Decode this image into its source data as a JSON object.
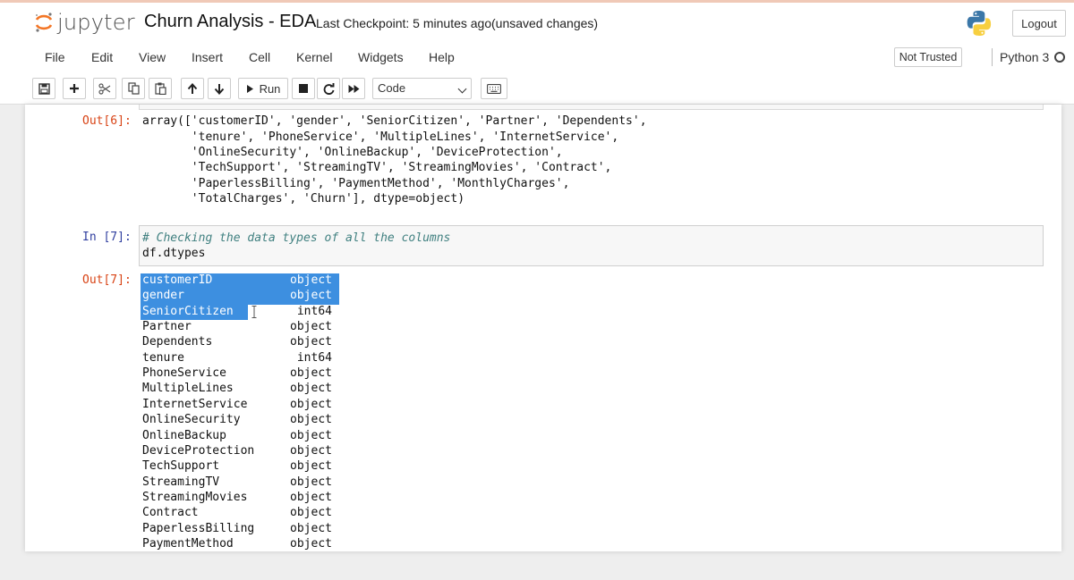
{
  "header": {
    "logo_text": "jupyter",
    "notebook_title": "Churn Analysis - EDA",
    "checkpoint": "Last Checkpoint: 5 minutes ago",
    "unsaved": "(unsaved changes)",
    "logout_label": "Logout"
  },
  "menubar": {
    "items": [
      "File",
      "Edit",
      "View",
      "Insert",
      "Cell",
      "Kernel",
      "Widgets",
      "Help"
    ],
    "trust_label": "Not Trusted",
    "kernel_name": "Python 3"
  },
  "toolbar": {
    "run_label": "Run",
    "cell_type": "Code"
  },
  "cells": {
    "out6_prompt": "Out[6]:",
    "out6_lines": [
      "array(['customerID', 'gender', 'SeniorCitizen', 'Partner', 'Dependents',",
      "       'tenure', 'PhoneService', 'MultipleLines', 'InternetService',",
      "       'OnlineSecurity', 'OnlineBackup', 'DeviceProtection',",
      "       'TechSupport', 'StreamingTV', 'StreamingMovies', 'Contract',",
      "       'PaperlessBilling', 'PaymentMethod', 'MonthlyCharges',",
      "       'TotalCharges', 'Churn'], dtype=object)"
    ],
    "in7_prompt": "In [7]:",
    "in7_comment": "# Checking the data types of all the columns",
    "in7_code": "df.dtypes",
    "out7_prompt": "Out[7]:",
    "dtypes": [
      {
        "name": "customerID",
        "type": "object"
      },
      {
        "name": "gender",
        "type": "object"
      },
      {
        "name": "SeniorCitizen",
        "type": "int64"
      },
      {
        "name": "Partner",
        "type": "object"
      },
      {
        "name": "Dependents",
        "type": "object"
      },
      {
        "name": "tenure",
        "type": "int64"
      },
      {
        "name": "PhoneService",
        "type": "object"
      },
      {
        "name": "MultipleLines",
        "type": "object"
      },
      {
        "name": "InternetService",
        "type": "object"
      },
      {
        "name": "OnlineSecurity",
        "type": "object"
      },
      {
        "name": "OnlineBackup",
        "type": "object"
      },
      {
        "name": "DeviceProtection",
        "type": "object"
      },
      {
        "name": "TechSupport",
        "type": "object"
      },
      {
        "name": "StreamingTV",
        "type": "object"
      },
      {
        "name": "StreamingMovies",
        "type": "object"
      },
      {
        "name": "Contract",
        "type": "object"
      },
      {
        "name": "PaperlessBilling",
        "type": "object"
      },
      {
        "name": "PaymentMethod",
        "type": "object"
      }
    ]
  },
  "colors": {
    "selection": "#3d8fe0",
    "out_prompt": "#d84315",
    "in_prompt": "#303f9f"
  }
}
